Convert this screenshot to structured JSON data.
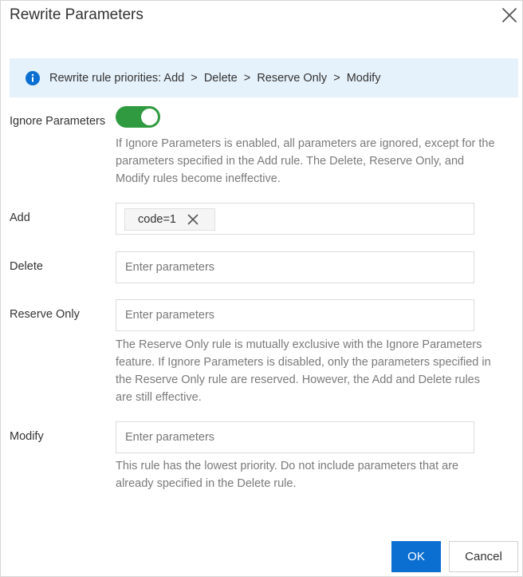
{
  "dialog": {
    "title": "Rewrite Parameters",
    "info": "Rewrite rule priorities: Add  >  Delete  >  Reserve Only  >  Modify",
    "ignore": {
      "label": "Ignore Parameters",
      "enabled": true,
      "help": "If Ignore Parameters is enabled, all parameters are ignored, except for the parameters specified in the Add rule. The Delete, Reserve Only, and Modify rules become ineffective."
    },
    "add": {
      "label": "Add",
      "tags": [
        "code=1"
      ]
    },
    "delete": {
      "label": "Delete",
      "placeholder": "Enter parameters"
    },
    "reserve": {
      "label": "Reserve Only",
      "placeholder": "Enter parameters",
      "help": "The Reserve Only rule is mutually exclusive with the Ignore Parameters feature. If Ignore Parameters is disabled, only the parameters specified in the Reserve Only rule are reserved. However, the Add and Delete rules are still effective."
    },
    "modify": {
      "label": "Modify",
      "placeholder": "Enter parameters",
      "help": "This rule has the lowest priority. Do not include parameters that are already specified in the Delete rule."
    },
    "ok_label": "OK",
    "cancel_label": "Cancel"
  },
  "colors": {
    "accent": "#0b6fd1",
    "toggle_on": "#2f9a3f",
    "info_bg": "#e6f2fb"
  },
  "icons": {
    "close": "close-icon",
    "info": "info-icon",
    "tag_remove": "close-icon"
  }
}
